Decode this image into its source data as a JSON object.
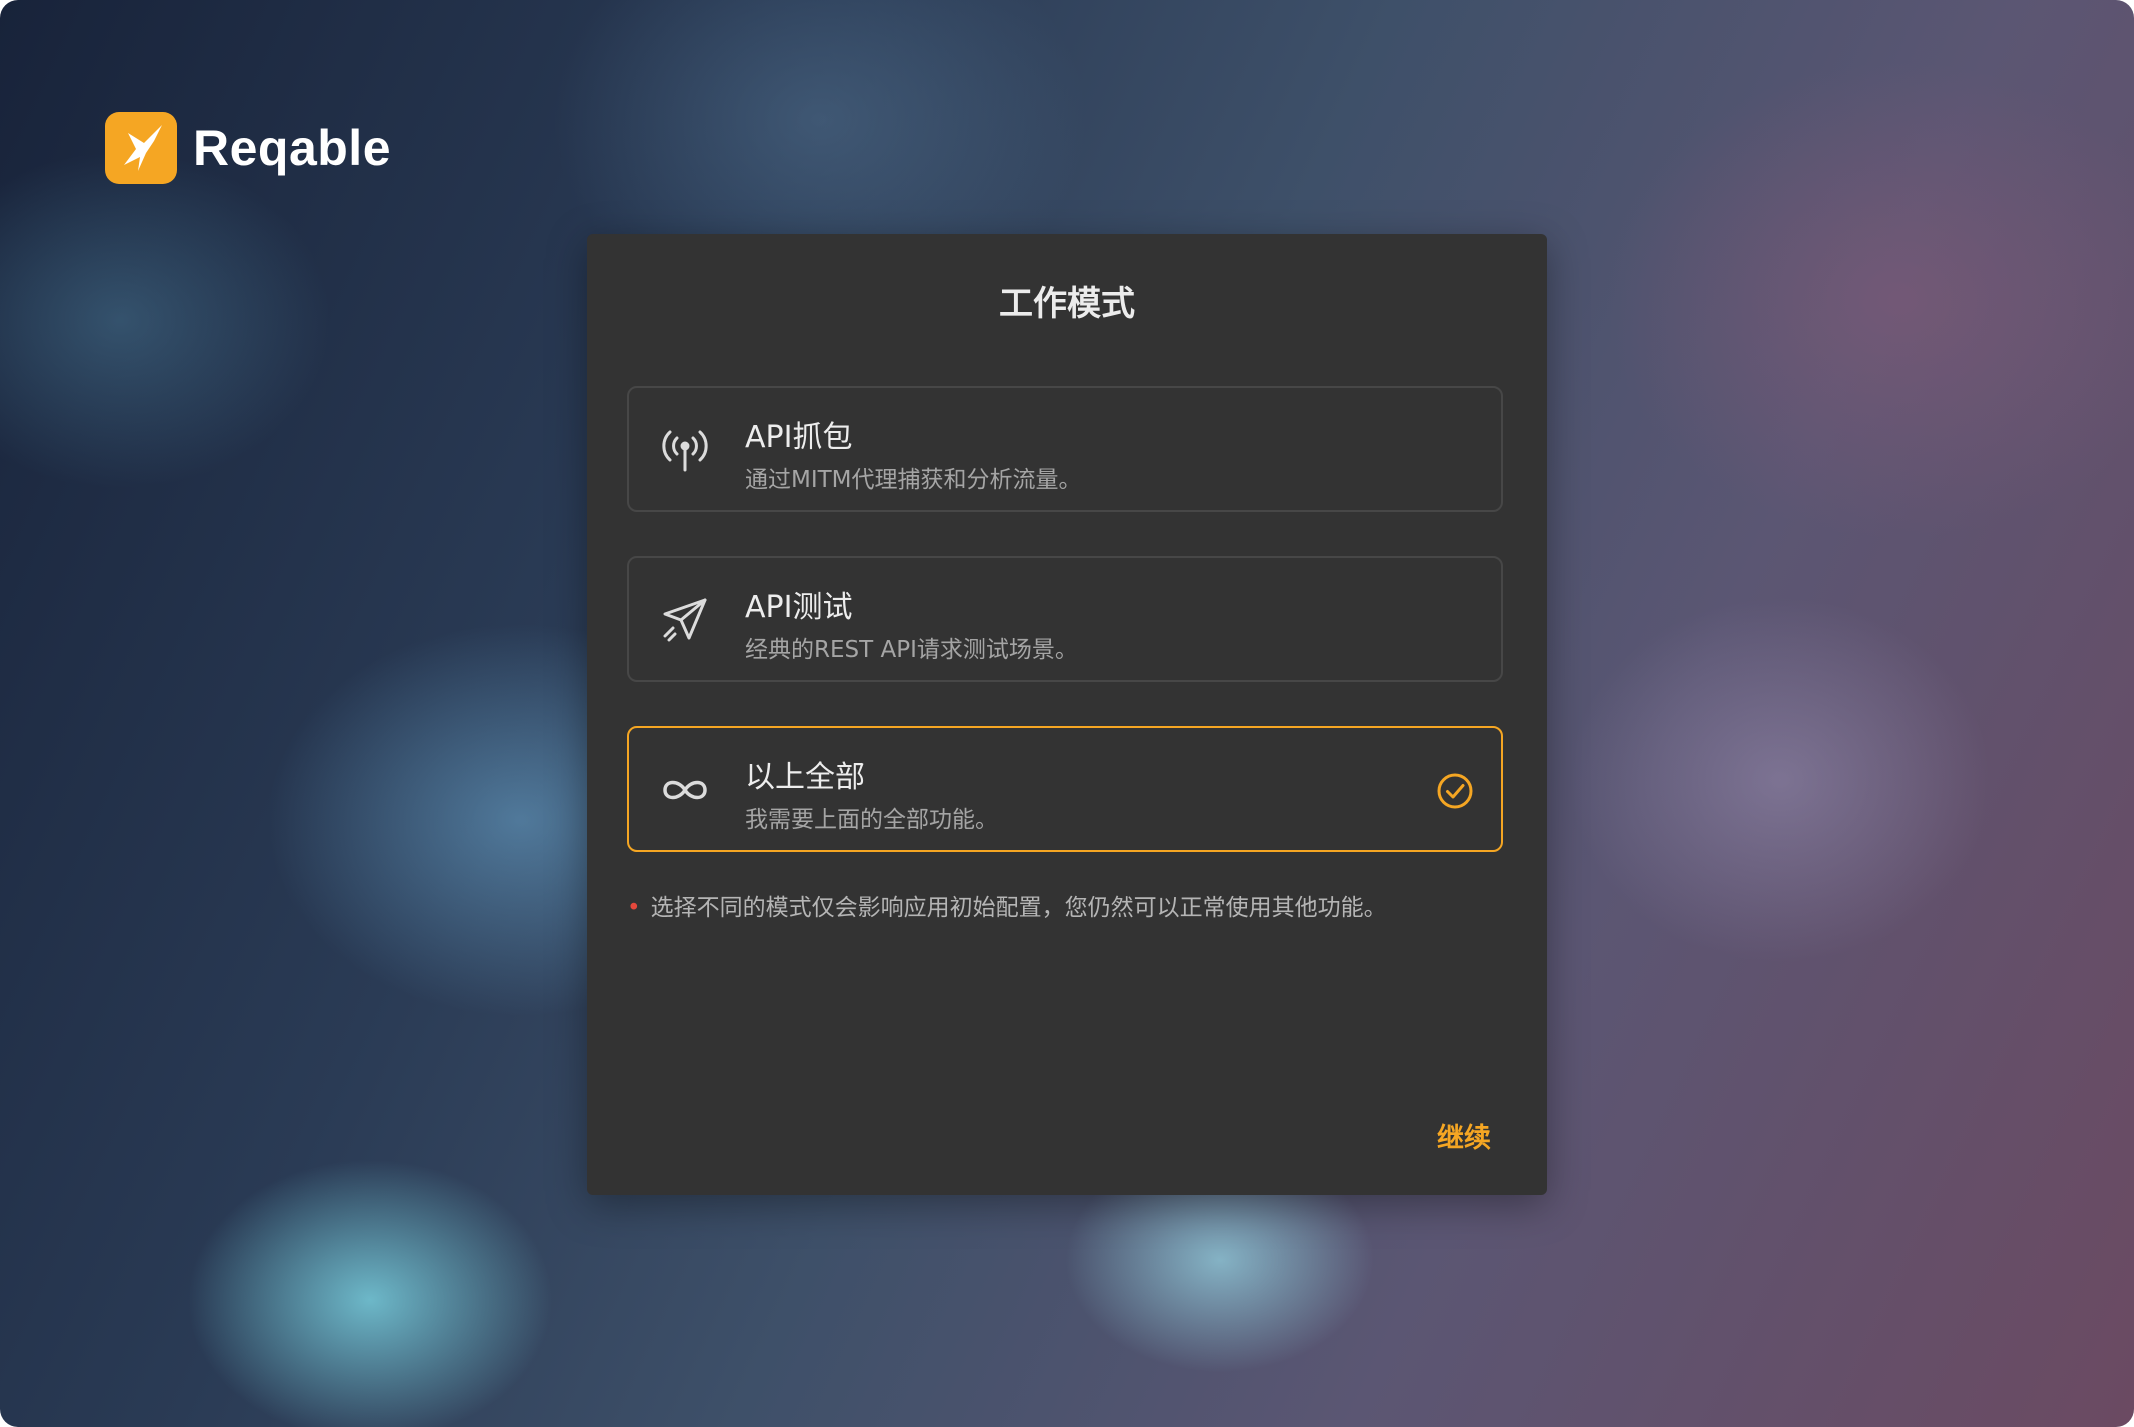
{
  "brand": {
    "name": "Reqable",
    "logo_icon": "hummingbird-icon",
    "logo_color": "#f5a623"
  },
  "dialog": {
    "title": "工作模式",
    "options": [
      {
        "title": "API抓包",
        "description": "通过MITM代理捕获和分析流量。",
        "icon": "antenna-icon",
        "selected": false
      },
      {
        "title": "API测试",
        "description": "经典的REST API请求测试场景。",
        "icon": "paper-plane-icon",
        "selected": false
      },
      {
        "title": "以上全部",
        "description": "我需要上面的全部功能。",
        "icon": "infinity-icon",
        "selected": true
      }
    ],
    "note": "选择不同的模式仅会影响应用初始配置，您仍然可以正常使用其他功能。",
    "continue_label": "继续"
  },
  "colors": {
    "accent": "#f5a623",
    "dialog_bg": "#333333",
    "note_bullet": "#e5483c"
  }
}
